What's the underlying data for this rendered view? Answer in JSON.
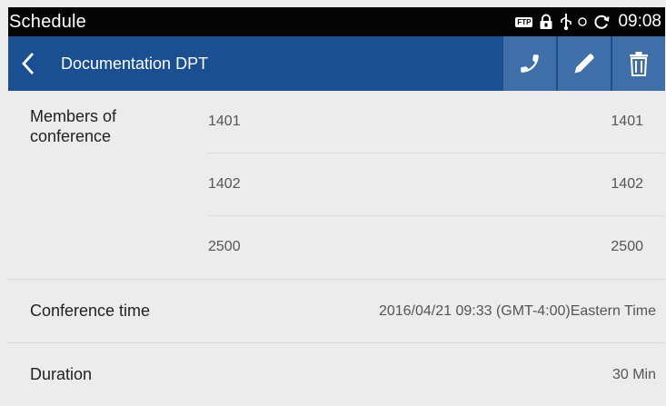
{
  "status_bar": {
    "title": "Schedule",
    "ftp_label": "FTP",
    "time": "09:08"
  },
  "action_bar": {
    "title": "Documentation DPT"
  },
  "members": {
    "label_line1": "Members of",
    "label_line2": "conference",
    "items": [
      {
        "left": "1401",
        "right": "1401"
      },
      {
        "left": "1402",
        "right": "1402"
      },
      {
        "left": "2500",
        "right": "2500"
      }
    ]
  },
  "conference_time": {
    "label": "Conference time",
    "value": "2016/04/21 09:33 (GMT-4:00)Eastern Time"
  },
  "duration": {
    "label": "Duration",
    "value": "30 Min"
  }
}
